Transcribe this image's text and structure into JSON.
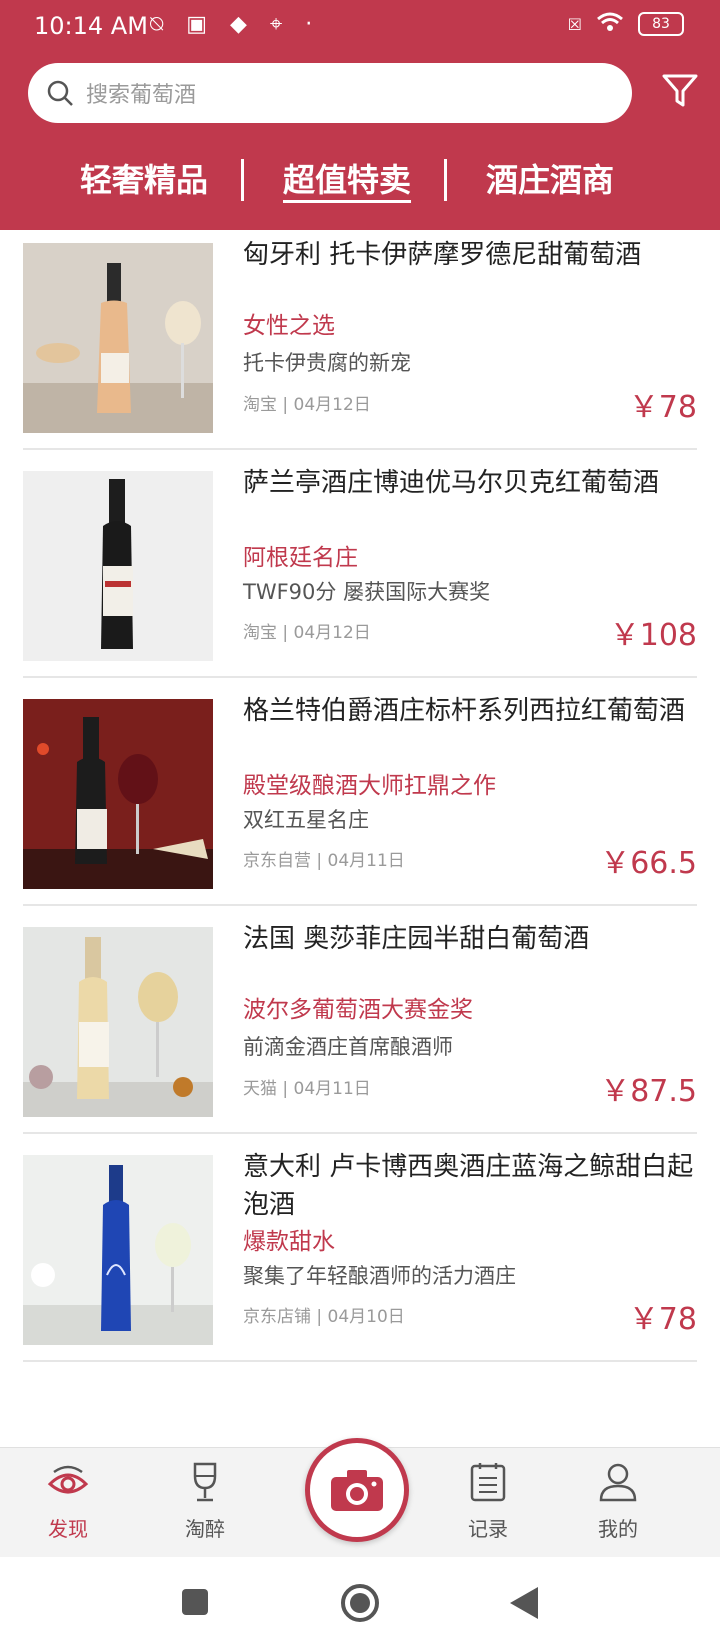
{
  "status": {
    "time": "10:14 AM",
    "battery": "83"
  },
  "search": {
    "placeholder": "搜索葡萄酒"
  },
  "tabs": [
    {
      "label": "轻奢精品",
      "active": false
    },
    {
      "label": "超值特卖",
      "active": true
    },
    {
      "label": "酒庄酒商",
      "active": false
    }
  ],
  "products": [
    {
      "title": "匈牙利 托卡伊萨摩罗德尼甜葡萄酒",
      "tagline": "女性之选",
      "desc": "托卡伊贵腐的新宠",
      "meta": "淘宝 | 04月12日",
      "price": "￥78"
    },
    {
      "title": "萨兰亭酒庄博迪优马尔贝克红葡萄酒",
      "tagline": "阿根廷名庄",
      "desc": "TWF90分 屡获国际大赛奖",
      "meta": "淘宝 | 04月12日",
      "price": "￥108"
    },
    {
      "title": "格兰特伯爵酒庄标杆系列西拉红葡萄酒",
      "tagline": "殿堂级酿酒大师扛鼎之作",
      "desc": "双红五星名庄",
      "meta": "京东自营 | 04月11日",
      "price": "￥66.5"
    },
    {
      "title": "法国 奥莎菲庄园半甜白葡萄酒",
      "tagline": "波尔多葡萄酒大赛金奖",
      "desc": "前滴金酒庄首席酿酒师",
      "meta": "天猫 | 04月11日",
      "price": "￥87.5"
    },
    {
      "title": "意大利 卢卡博西奥酒庄蓝海之鲸甜白起泡酒",
      "tagline": "爆款甜水",
      "desc": "聚集了年轻酿酒师的活力酒庄",
      "meta": "京东店铺 | 04月10日",
      "price": "￥78"
    }
  ],
  "nav": [
    {
      "label": "发现",
      "icon": "eye-icon",
      "active": true
    },
    {
      "label": "淘醉",
      "icon": "wine-glass-icon",
      "active": false
    },
    {
      "label": "",
      "icon": "camera-icon",
      "active": false
    },
    {
      "label": "记录",
      "icon": "clipboard-icon",
      "active": false
    },
    {
      "label": "我的",
      "icon": "person-icon",
      "active": false
    }
  ],
  "colors": {
    "brand": "#c0394d",
    "text": "#222222",
    "muted": "#9a9a9a"
  }
}
